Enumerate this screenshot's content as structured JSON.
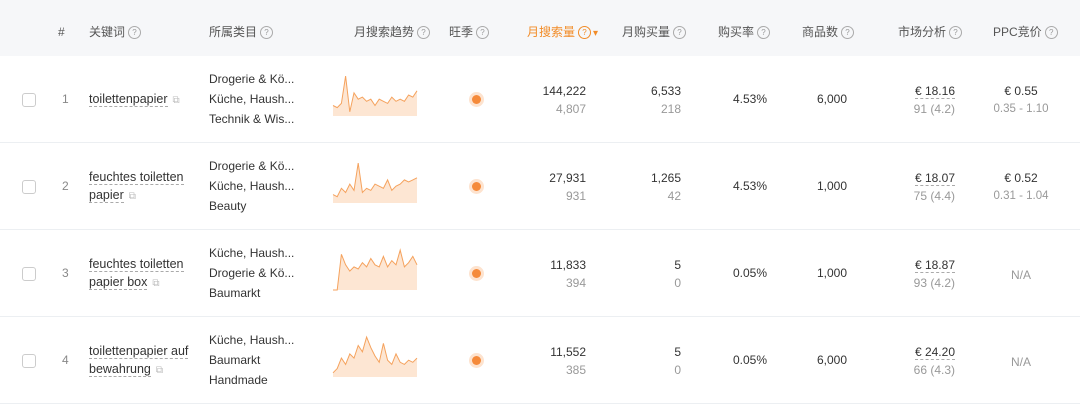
{
  "header": {
    "index": "#",
    "keyword": "关键词",
    "category": "所属类目",
    "trend": "月搜索趋势",
    "peak": "旺季",
    "search_volume": "月搜索量",
    "purchase_volume": "月购买量",
    "purchase_rate": "购买率",
    "product_count": "商品数",
    "market": "市场分析",
    "ppc": "PPC竞价",
    "help_icon": "?",
    "sort_icon": "chevron-down-icon"
  },
  "accent_color": "#f28c28",
  "rows": [
    {
      "index": "1",
      "keyword": "toilettenpapier",
      "categories": [
        "Drogerie & Kö...",
        "Küche, Haush...",
        "Technik & Wis..."
      ],
      "trend": [
        0.25,
        0.2,
        0.3,
        0.95,
        0.1,
        0.55,
        0.4,
        0.45,
        0.35,
        0.4,
        0.25,
        0.4,
        0.35,
        0.3,
        0.45,
        0.35,
        0.4,
        0.35,
        0.5,
        0.45,
        0.6
      ],
      "peak": true,
      "search_volume": "144,222",
      "search_volume_sub": "4,807",
      "purchase_volume": "6,533",
      "purchase_volume_sub": "218",
      "purchase_rate": "4.53%",
      "product_count": "6,000",
      "market_price": "€ 18.16",
      "market_rating": "91 (4.2)",
      "ppc": "€ 0.55",
      "ppc_range": "0.35 - 1.10"
    },
    {
      "index": "2",
      "keyword": "feuchtes toiletten papier",
      "categories": [
        "Drogerie & Kö...",
        "Küche, Haush...",
        "Beauty"
      ],
      "trend": [
        0.2,
        0.15,
        0.35,
        0.25,
        0.45,
        0.3,
        0.95,
        0.25,
        0.35,
        0.3,
        0.45,
        0.4,
        0.35,
        0.55,
        0.3,
        0.4,
        0.45,
        0.55,
        0.5,
        0.55,
        0.6
      ],
      "peak": true,
      "search_volume": "27,931",
      "search_volume_sub": "931",
      "purchase_volume": "1,265",
      "purchase_volume_sub": "42",
      "purchase_rate": "4.53%",
      "product_count": "1,000",
      "market_price": "€ 18.07",
      "market_rating": "75 (4.4)",
      "ppc": "€ 0.52",
      "ppc_range": "0.31 - 1.04"
    },
    {
      "index": "3",
      "keyword": "feuchtes toiletten papier box",
      "categories": [
        "Küche, Haush...",
        "Drogerie & Kö...",
        "Baumarkt"
      ],
      "trend": [
        0.0,
        0.0,
        0.85,
        0.6,
        0.45,
        0.55,
        0.5,
        0.65,
        0.55,
        0.75,
        0.6,
        0.55,
        0.8,
        0.55,
        0.7,
        0.6,
        0.95,
        0.55,
        0.65,
        0.8,
        0.6
      ],
      "peak": true,
      "search_volume": "11,833",
      "search_volume_sub": "394",
      "purchase_volume": "5",
      "purchase_volume_sub": "0",
      "purchase_rate": "0.05%",
      "product_count": "1,000",
      "market_price": "€ 18.87",
      "market_rating": "93 (4.2)",
      "ppc": "N/A",
      "ppc_range": ""
    },
    {
      "index": "4",
      "keyword": "toilettenpapier auf bewahrung",
      "categories": [
        "Küche, Haush...",
        "Baumarkt",
        "Handmade"
      ],
      "trend": [
        0.1,
        0.2,
        0.45,
        0.3,
        0.55,
        0.45,
        0.75,
        0.6,
        0.95,
        0.7,
        0.5,
        0.35,
        0.8,
        0.4,
        0.3,
        0.55,
        0.35,
        0.3,
        0.4,
        0.35,
        0.45
      ],
      "peak": true,
      "search_volume": "11,552",
      "search_volume_sub": "385",
      "purchase_volume": "5",
      "purchase_volume_sub": "0",
      "purchase_rate": "0.05%",
      "product_count": "6,000",
      "market_price": "€ 24.20",
      "market_rating": "66 (4.3)",
      "ppc": "N/A",
      "ppc_range": ""
    }
  ]
}
